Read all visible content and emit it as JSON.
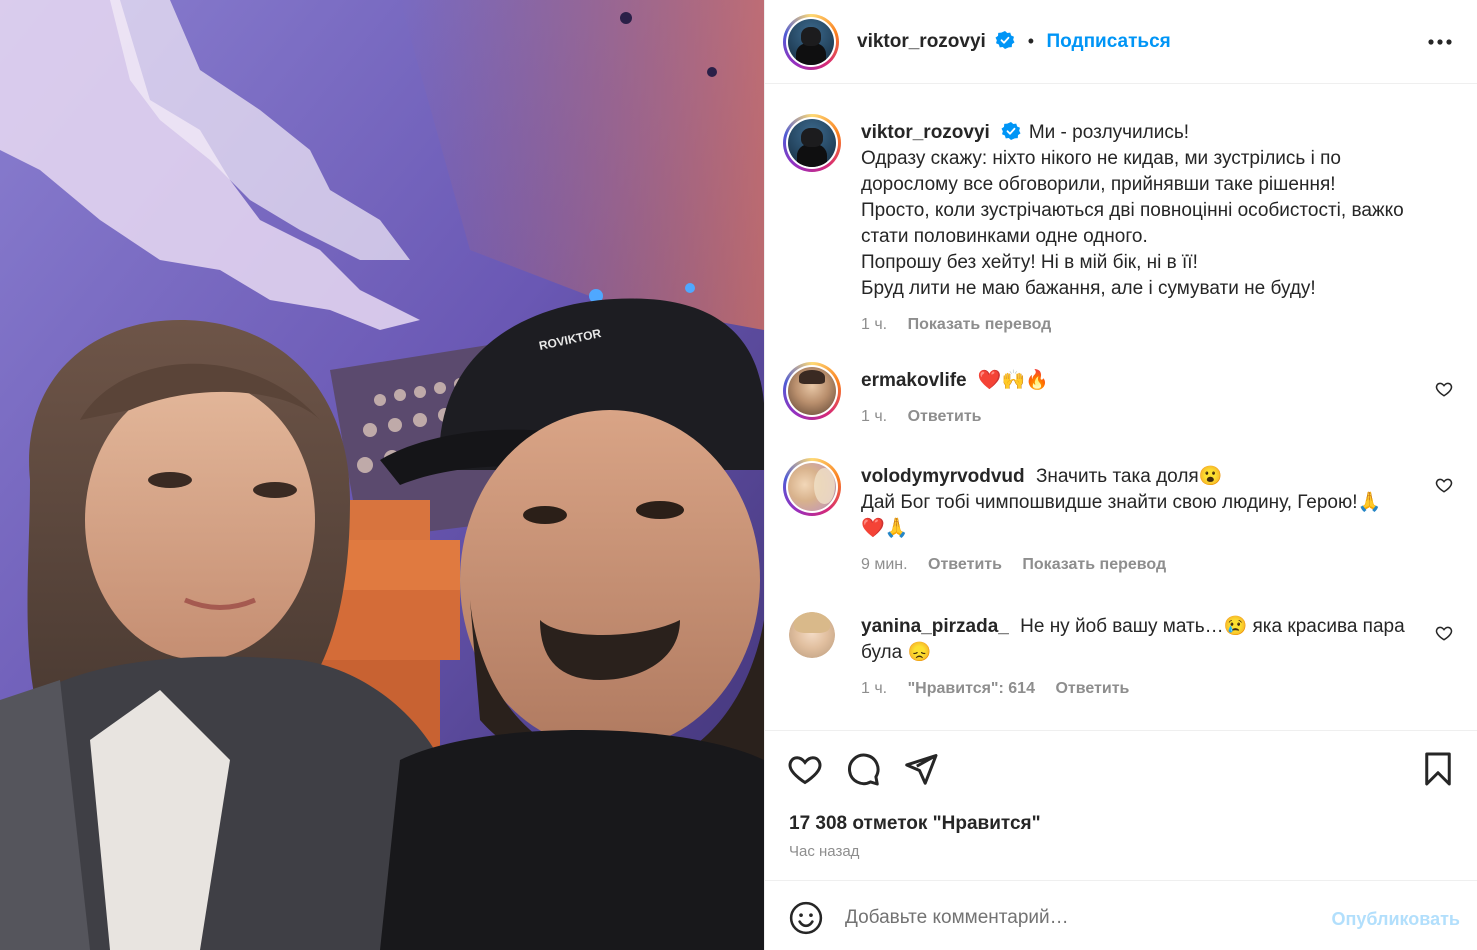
{
  "post": {
    "author": "viktor_rozovyi",
    "follow_label": "Подписаться",
    "separator": "•",
    "caption_lines": [
      "Ми - розлучились!",
      "Одразу скажу: ніхто нікого не кидав, ми зустрілись і по",
      "дорослому все обговорили, прийнявши таке рішення!",
      "Просто, коли зустрічаються дві повноцінні особистості, важко",
      "стати половинками одне одного.",
      "Попрошу без хейту! Ні в мій бік, ні в її!",
      "Бруд лити не маю бажання, але і сумувати не буду!"
    ],
    "caption_time": "1 ч.",
    "caption_translate": "Показать перевод"
  },
  "comments": [
    {
      "user": "ermakovlife",
      "text": "❤️🙌🔥",
      "time": "1 ч.",
      "reply": "Ответить"
    },
    {
      "user": "volodymyrvodvud",
      "text_line1": "Значить така доля😮",
      "text_line2": "Дай Бог тобі чимпошвидше знайти свою людину, Герою!🙏",
      "text_line3": "❤️🙏",
      "time": "9 мин.",
      "reply": "Ответить",
      "translate": "Показать перевод"
    },
    {
      "user": "yanina_pirzada_",
      "text_line1": "Не ну йоб вашу мать…😢 яка красива пара",
      "text_line2": "була 😞",
      "time": "1 ч.",
      "likes": "\"Нравится\": 614",
      "reply": "Ответить"
    }
  ],
  "actions": {
    "likes_count": "17 308 отметок \"Нравится\"",
    "posted_ago": "Час назад"
  },
  "composer": {
    "placeholder": "Добавьте комментарий…",
    "post_label": "Опубликовать"
  },
  "colors": {
    "accent": "#0095f6",
    "verified": "#0095f6",
    "heart_red": "#ed4956",
    "muted": "#8e8e8e",
    "post_disabled": "#b2dffc"
  },
  "icons": [
    "verified-badge-icon",
    "more-options-icon",
    "heart-icon",
    "comment-icon",
    "share-icon",
    "bookmark-icon",
    "emoji-icon"
  ]
}
